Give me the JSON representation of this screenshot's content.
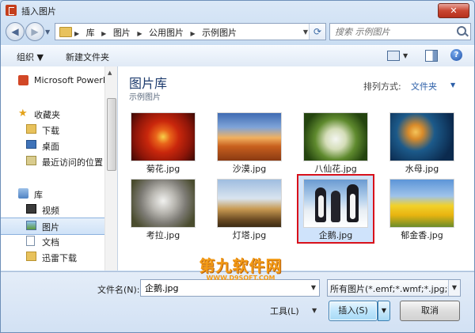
{
  "window": {
    "title": "插入图片",
    "close_label": "✕"
  },
  "address": {
    "crumbs": [
      "库",
      "图片",
      "公用图片",
      "示例图片"
    ]
  },
  "search": {
    "placeholder": "搜索 示例图片"
  },
  "toolbar": {
    "organize_label": "组织 ▼",
    "new_folder_label": "新建文件夹"
  },
  "sidebar": {
    "items": [
      {
        "label": "Microsoft PowerPoint",
        "icon": "powerpoint-icon"
      },
      {
        "label": "收藏夹",
        "icon": "star-icon"
      },
      {
        "label": "下载",
        "icon": "download-folder-icon"
      },
      {
        "label": "桌面",
        "icon": "desktop-icon"
      },
      {
        "label": "最近访问的位置",
        "icon": "recent-places-icon"
      },
      {
        "label": "库",
        "icon": "library-icon"
      },
      {
        "label": "视频",
        "icon": "video-icon"
      },
      {
        "label": "图片",
        "icon": "pictures-icon",
        "selected": true
      },
      {
        "label": "文档",
        "icon": "documents-icon"
      },
      {
        "label": "迅雷下载",
        "icon": "xunlei-download-icon"
      }
    ]
  },
  "library": {
    "title": "图片库",
    "subtitle": "示例图片",
    "sort_label": "排列方式:",
    "sort_value": "文件夹"
  },
  "files": [
    {
      "name": "菊花.jpg"
    },
    {
      "name": "沙漠.jpg"
    },
    {
      "name": "八仙花.jpg"
    },
    {
      "name": "水母.jpg"
    },
    {
      "name": "考拉.jpg"
    },
    {
      "name": "灯塔.jpg"
    },
    {
      "name": "企鹅.jpg",
      "selected": true
    },
    {
      "name": "郁金香.jpg"
    }
  ],
  "bottom": {
    "filename_label": "文件名(N):",
    "filename_value": "企鹅.jpg",
    "filter_value": "所有图片(*.emf;*.wmf;*.jpg;*.jp",
    "tools_label": "工具(L)",
    "insert_label": "插入(S)",
    "cancel_label": "取消"
  },
  "watermark": {
    "main": "第九软件网",
    "sub": "WWW.D9SOFT.COM"
  }
}
